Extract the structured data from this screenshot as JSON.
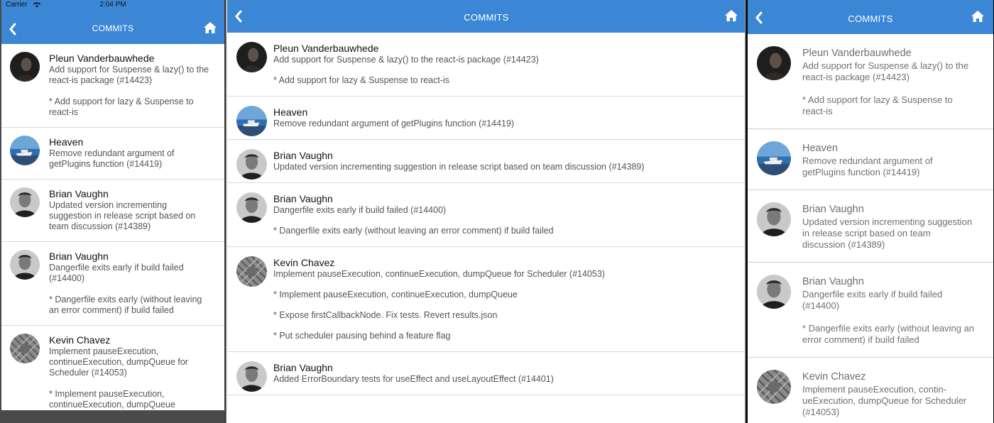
{
  "nav": {
    "title": "COMMITS"
  },
  "status": {
    "carrier": "Carrier",
    "time": "2:04 PM"
  },
  "colors": {
    "accent": "#3b87d6",
    "divider": "#d8d8d8"
  },
  "icons": {
    "back": "chevron-left-icon",
    "home": "home-icon"
  },
  "panel1": {
    "commits": [
      {
        "author": "Pleun Vanderbauwhede",
        "avatar": "dark",
        "lines": [
          "Add support for Suspense & lazy() to the",
          "react-is package (#14423)"
        ],
        "details": [
          [
            "* Add support for lazy & Suspense to",
            "react-is"
          ]
        ]
      },
      {
        "author": "Heaven",
        "avatar": "sea",
        "lines": [
          "Remove redundant argument of",
          "getPlugins function (#14419)"
        ],
        "details": []
      },
      {
        "author": "Brian Vaughn",
        "avatar": "face",
        "lines": [
          "Updated version incrementing",
          "suggestion in release script based on",
          "team discussion (#14389)"
        ],
        "details": []
      },
      {
        "author": "Brian Vaughn",
        "avatar": "face",
        "lines": [
          "Dangerfile exits early if build failed",
          "(#14400)"
        ],
        "details": [
          [
            "* Dangerfile exits early (without leaving",
            "an error comment) if build failed"
          ]
        ]
      },
      {
        "author": "Kevin Chavez",
        "avatar": "tree",
        "lines": [
          "Implement pauseExecution,",
          "continueExecution, dumpQueue for",
          "Scheduler (#14053)"
        ],
        "details": [
          [
            "* Implement pauseExecution,",
            "continueExecution, dumpQueue"
          ]
        ]
      }
    ]
  },
  "panel2": {
    "commits": [
      {
        "author": "Pleun Vanderbauwhede",
        "avatar": "dark",
        "lines": [
          "Add support for Suspense & lazy() to the react-is package (#14423)"
        ],
        "details": [
          [
            "* Add support for lazy & Suspense to react-is"
          ]
        ]
      },
      {
        "author": "Heaven",
        "avatar": "sea",
        "lines": [
          "Remove redundant argument of getPlugins function (#14419)"
        ],
        "details": []
      },
      {
        "author": "Brian Vaughn",
        "avatar": "face",
        "lines": [
          "Updated version incrementing suggestion in release script based on team discussion (#14389)"
        ],
        "details": []
      },
      {
        "author": "Brian Vaughn",
        "avatar": "face",
        "lines": [
          "Dangerfile exits early if build failed (#14400)"
        ],
        "details": [
          [
            "* Dangerfile exits early (without leaving an error comment) if build failed"
          ]
        ]
      },
      {
        "author": "Kevin Chavez",
        "avatar": "tree",
        "lines": [
          "Implement pauseExecution, continueExecution, dumpQueue for Scheduler (#14053)"
        ],
        "details": [
          [
            "* Implement pauseExecution, continueExecution, dumpQueue"
          ],
          [
            "* Expose firstCallbackNode. Fix tests. Revert results.json"
          ],
          [
            "* Put scheduler pausing behind a feature flag"
          ]
        ]
      },
      {
        "author": "Brian Vaughn",
        "avatar": "face",
        "lines": [
          "Added ErrorBoundary tests for useEffect and useLayoutEffect (#14401)"
        ],
        "details": []
      }
    ]
  },
  "panel3": {
    "commits": [
      {
        "author": "Pleun Vanderbauwhede",
        "avatar": "dark",
        "lines": [
          "Add support for Suspense & lazy() to the",
          "react-is package (#14423)"
        ],
        "details": [
          [
            "* Add support for lazy & Suspense to",
            "react-is"
          ]
        ]
      },
      {
        "author": "Heaven",
        "avatar": "sea",
        "lines": [
          "Remove redundant argument of",
          "getPlugins function (#14419)"
        ],
        "details": []
      },
      {
        "author": "Brian Vaughn",
        "avatar": "face",
        "lines": [
          "Updated version incrementing suggestion",
          "in release script based on team",
          "discussion (#14389)"
        ],
        "details": []
      },
      {
        "author": "Brian Vaughn",
        "avatar": "face",
        "lines": [
          "Dangerfile exits early if build failed",
          "(#14400)"
        ],
        "details": [
          [
            "* Dangerfile exits early (without leaving an",
            "error comment) if build failed"
          ]
        ]
      },
      {
        "author": "Kevin Chavez",
        "avatar": "tree",
        "lines": [
          "Implement pauseExecution, contin-",
          "ueExecution, dumpQueue for Scheduler",
          "(#14053)"
        ],
        "details": []
      }
    ]
  }
}
